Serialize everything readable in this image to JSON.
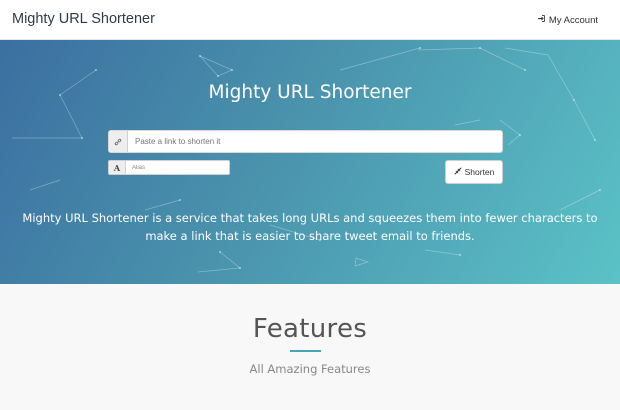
{
  "navbar": {
    "brand": "Mighty URL Shortener",
    "account_label": "My Account",
    "account_icon": "sign-in-icon"
  },
  "hero": {
    "title": "Mighty URL Shortener",
    "url_input": {
      "placeholder": "Paste a link to shorten it",
      "value": "",
      "icon": "link-icon"
    },
    "alias_input": {
      "placeholder": "Alias",
      "value": "",
      "icon": "font-icon",
      "icon_glyph": "A"
    },
    "shorten_button": {
      "label": "Shorten",
      "icon": "compress-icon"
    },
    "description": "Mighty URL Shortener is a service that takes long URLs and squeezes them into fewer characters to make a link that is easier to share tweet email to friends."
  },
  "features": {
    "title": "Features",
    "subtitle": "All Amazing Features"
  },
  "colors": {
    "gradient_start": "#3b6fa0",
    "gradient_end": "#5bc2c7",
    "accent": "#4aa3b6"
  }
}
